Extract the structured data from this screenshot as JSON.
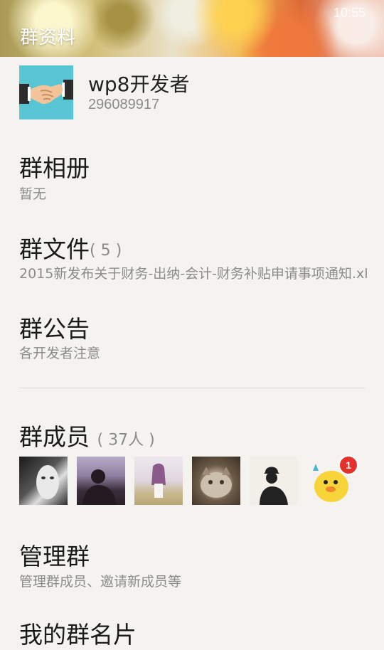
{
  "status_bar": {
    "time": "10:55"
  },
  "header": {
    "title": "群资料"
  },
  "group": {
    "name": "wp8开发者",
    "id": "296089917"
  },
  "sections": {
    "album": {
      "title": "群相册",
      "subtitle": "暂无"
    },
    "files": {
      "title": "群文件",
      "count": "( 5 )",
      "subtitle": "2015新发布关于财务-出纳-会计-财务补贴申请事项通知.xl"
    },
    "notice": {
      "title": "群公告",
      "subtitle": "各开发者注意"
    },
    "members": {
      "title": "群成员",
      "count": "( 37人 )",
      "avatars": [
        "member-avatar-1",
        "member-avatar-2",
        "member-avatar-3",
        "member-avatar-4",
        "member-avatar-5",
        "member-avatar-6"
      ],
      "badge": "1"
    },
    "manage": {
      "title": "管理群",
      "subtitle": "管理群成员、邀请新成员等"
    },
    "card": {
      "title": "我的群名片"
    }
  },
  "colors": {
    "background": "#f4f3ef",
    "avatar_bg": "#58c6d2",
    "badge": "#e5312b"
  }
}
